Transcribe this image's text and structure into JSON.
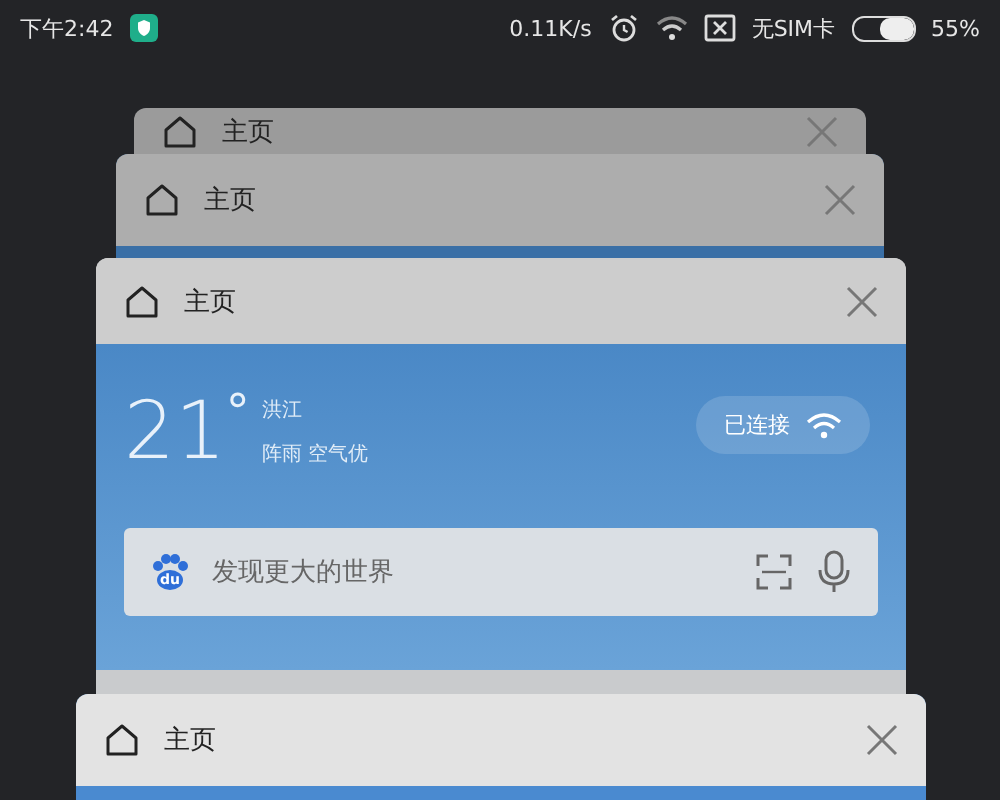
{
  "status_bar": {
    "time": "下午2:42",
    "net_speed": "0.11K/s",
    "sim": "无SIM卡",
    "battery": {
      "level": 0.55
    },
    "battery_text": "55%"
  },
  "cards": [
    {
      "title": "主页"
    },
    {
      "title": "主页"
    },
    {
      "title": "主页"
    },
    {
      "title": "主页"
    }
  ],
  "weather": {
    "temperature": "21",
    "degree": "°",
    "city": "洪江",
    "condition": "阵雨 空气优"
  },
  "wifi_status": "已连接",
  "search": {
    "logo_text": "du",
    "placeholder": "发现更大的世界"
  }
}
